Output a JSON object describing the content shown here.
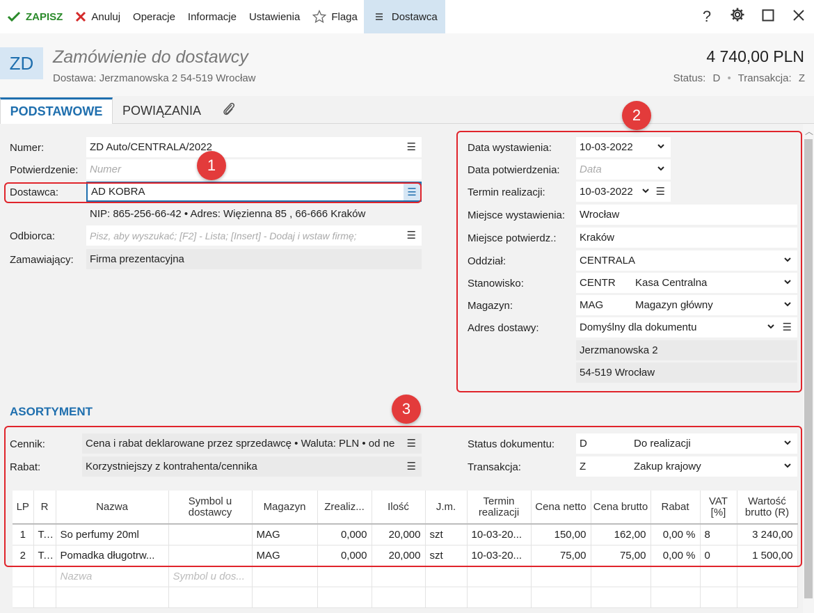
{
  "toolbar": {
    "save": "ZAPISZ",
    "cancel": "Anuluj",
    "operations": "Operacje",
    "information": "Informacje",
    "settings": "Ustawienia",
    "flag": "Flaga",
    "supplier": "Dostawca",
    "help": "?"
  },
  "header": {
    "badge": "ZD",
    "title": "Zamówienie do dostawcy",
    "delivery": "Dostawa: Jerzmanowska 2 54-519 Wrocław",
    "amount": "4 740,00 PLN",
    "status_label": "Status:",
    "status_value": "D",
    "transaction_label": "Transakcja:",
    "transaction_value": "Z"
  },
  "tabs": {
    "basic": "PODSTAWOWE",
    "related": "POWIĄZANIA"
  },
  "left": {
    "number_label": "Numer:",
    "number_value": "ZD Auto/CENTRALA/2022",
    "confirmation_label": "Potwierdzenie:",
    "confirmation_placeholder": "Numer",
    "supplier_label": "Dostawca:",
    "supplier_value": "AD KOBRA",
    "supplier_info": "NIP:  865-256-66-42  •  Adres:  Więzienna  85 , 66-666 Kraków",
    "recipient_label": "Odbiorca:",
    "recipient_placeholder": "Pisz, aby wyszukać; [F2] - Lista; [Insert] - Dodaj i wstaw firmę;",
    "orderer_label": "Zamawiający:",
    "orderer_value": "Firma prezentacyjna"
  },
  "right": {
    "issue_date_label": "Data wystawienia:",
    "issue_date_value": "10-03-2022",
    "confirm_date_label": "Data potwierdzenia:",
    "confirm_date_placeholder": "Data",
    "due_date_label": "Termin realizacji:",
    "due_date_value": "10-03-2022",
    "issue_place_label": "Miejsce wystawienia:",
    "issue_place_value": "Wrocław",
    "confirm_place_label": "Miejsce potwierdz.:",
    "confirm_place_value": "Kraków",
    "branch_label": "Oddział:",
    "branch_value": "CENTRALA",
    "station_label": "Stanowisko:",
    "station_code": "CENTR",
    "station_name": "Kasa Centralna",
    "warehouse_label": "Magazyn:",
    "warehouse_code": "MAG",
    "warehouse_name": "Magazyn główny",
    "delivery_addr_label": "Adres dostawy:",
    "delivery_addr_value": "Domyślny dla dokumentu",
    "addr_line1": "Jerzmanowska 2",
    "addr_line2": "54-519 Wrocław"
  },
  "assortment": {
    "title": "ASORTYMENT",
    "pricelist_label": "Cennik:",
    "pricelist_value": "Cena i rabat deklarowane przez sprzedawcę • Waluta: PLN • od ne",
    "discount_label": "Rabat:",
    "discount_value": "Korzystniejszy z kontrahenta/cennika",
    "doc_status_label": "Status dokumentu:",
    "doc_status_code": "D",
    "doc_status_name": "Do realizacji",
    "transaction_label": "Transakcja:",
    "transaction_code": "Z",
    "transaction_name": "Zakup krajowy"
  },
  "table": {
    "headers": [
      "LP",
      "R",
      "Nazwa",
      "Symbol u dostawcy",
      "Magazyn",
      "Zrealiz...",
      "Ilość",
      "J.m.",
      "Termin realizacji",
      "Cena netto",
      "Cena brutto",
      "Rabat",
      "VAT [%]",
      "Wartość brutto (R)"
    ],
    "rows": [
      [
        "1",
        "T...",
        "So perfumy 20ml",
        "",
        "MAG",
        "0,000",
        "20,000",
        "szt",
        "10-03-20...",
        "150,00",
        "162,00",
        "0,00 %",
        "8",
        "3 240,00"
      ],
      [
        "2",
        "T...",
        "Pomadka długotrw...",
        "",
        "MAG",
        "0,000",
        "20,000",
        "szt",
        "10-03-20...",
        "75,00",
        "75,00",
        "0,00 %",
        "0",
        "1 500,00"
      ]
    ],
    "placeholder_name": "Nazwa",
    "placeholder_symbol": "Symbol u dos..."
  },
  "callouts": {
    "one": "1",
    "two": "2",
    "three": "3"
  },
  "colors": {
    "accent": "#1f6fae",
    "save": "#2a8a2a",
    "callout": "#e0242b"
  }
}
